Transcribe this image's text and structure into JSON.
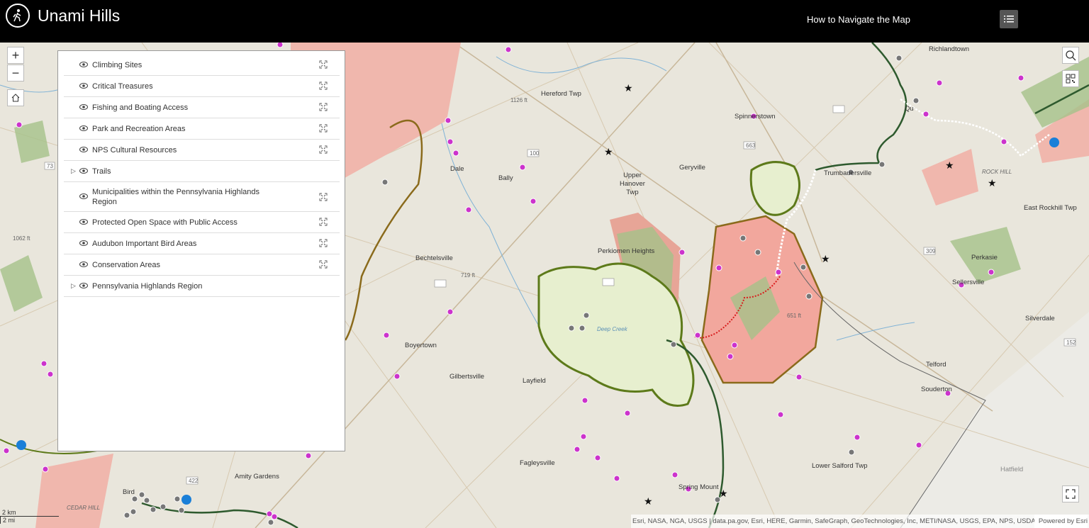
{
  "header": {
    "title": "Unami Hills",
    "nav_link": "How to Navigate the Map"
  },
  "colors": {
    "header_bg": "#000000",
    "basemap": "#e9e6dc",
    "protected_space": "#f2a79d",
    "forest": "#a5c28a",
    "conservation_area_fill": "#e7efcf",
    "conservation_area_border": "#5d7a1a",
    "highlands_border": "#8a6a1b",
    "poi_magenta": "#cc33cc",
    "poi_grey": "#777777",
    "trail_green": "#2e5a2e"
  },
  "layers": [
    {
      "label": "Climbing Sites",
      "expandable": false
    },
    {
      "label": "Critical Treasures",
      "expandable": false
    },
    {
      "label": "Fishing and Boating Access",
      "expandable": false
    },
    {
      "label": "Park and Recreation Areas",
      "expandable": false
    },
    {
      "label": "NPS Cultural Resources",
      "expandable": false
    },
    {
      "label": "Trails",
      "expandable": true
    },
    {
      "label": "Municipalities within the Pennsylvania Highlands Region",
      "expandable": false
    },
    {
      "label": "Protected Open Space with Public Access",
      "expandable": false
    },
    {
      "label": "Audubon Important Bird Areas",
      "expandable": false
    },
    {
      "label": "Conservation Areas",
      "expandable": false
    },
    {
      "label": "Pennsylvania Highlands Region",
      "expandable": true
    }
  ],
  "map_labels": {
    "richlandtown": "Richlandtown",
    "hereford_twp": "Hereford Twp",
    "elev_1126": "1126 ft",
    "spinnerstown": "Spinnerstown",
    "quakertown": "Qu",
    "upper_hanover": "Upper Hanover Twp",
    "geryville": "Geryville",
    "trumbauersville": "Trumbauersville",
    "rock_hill": "ROCK HILL",
    "east_rockhill": "East Rockhill Twp",
    "dale": "Dale",
    "bally": "Bally",
    "elev_1062": "1062 ft",
    "perkiomen_heights": "Perkiomen Heights",
    "bechtelsville": "Bechtelsville",
    "elev_719": "719 ft",
    "perkasie": "Perkasie",
    "sellersville": "Sellersville",
    "elev_651": "651 ft",
    "silverdale": "Silverdale",
    "boyertown": "Boyertown",
    "deep_creek": "Deep Creek",
    "gilbertsville": "Gilbertsville",
    "layfield": "Layfield",
    "telford": "Telford",
    "souderton": "Souderton",
    "fagleysville": "Fagleysville",
    "amity_gardens": "Amity Gardens",
    "lower_salford": "Lower Salford Twp",
    "hatfield": "Hatfield",
    "spring_mount": "Spring Mount",
    "cedar_hill": "CEDAR HILL",
    "birdsboro": "Bird",
    "road_100": "100",
    "road_663": "663",
    "road_73": "73",
    "road_422": "422",
    "road_309": "309",
    "road_152": "152"
  },
  "scale": {
    "km": "2 km",
    "mi": "2 mi"
  },
  "attribution": "Esri, NASA, NGA, USGS | data.pa.gov, Esri, HERE, Garmin, SafeGraph, GeoTechnologies, Inc, METI/NASA, USGS, EPA, NPS, USDA",
  "powered_by": "Powered by Esri"
}
